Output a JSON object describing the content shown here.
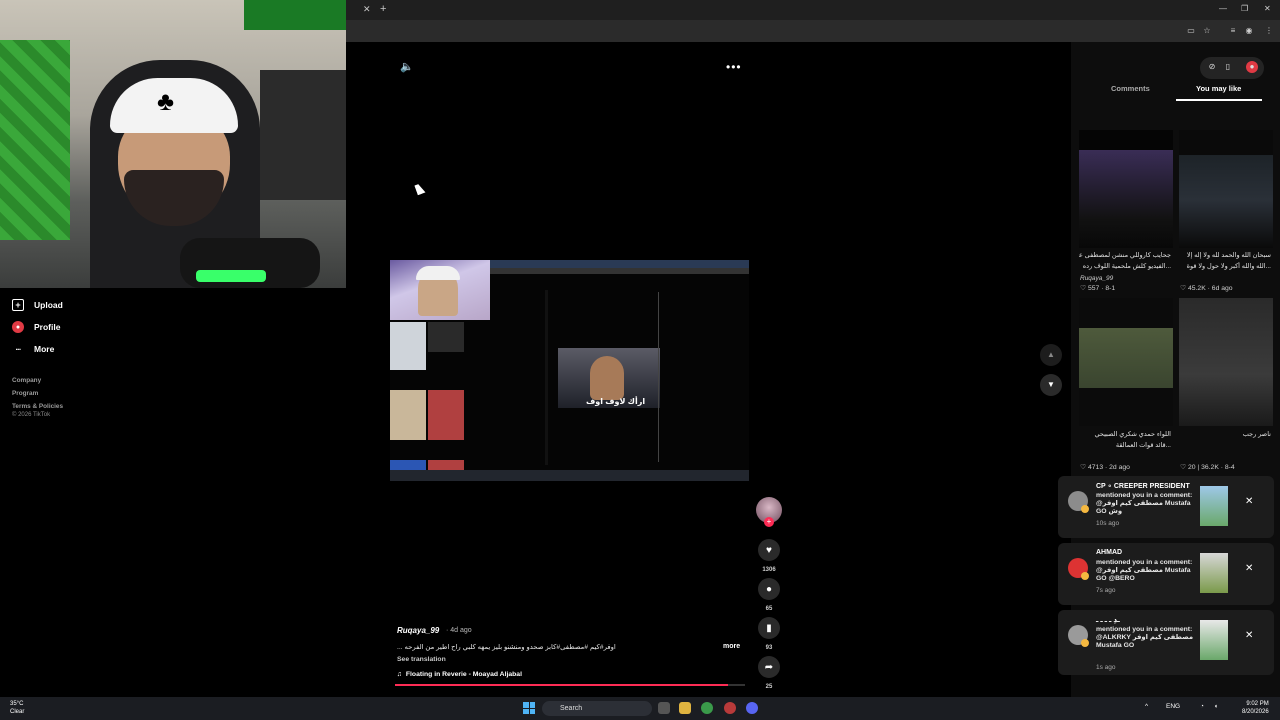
{
  "nav": {
    "upload": "Upload",
    "profile": "Profile",
    "more": "More",
    "footer": [
      "Company",
      "Program",
      "Terms & Policies"
    ],
    "copyright": "© 2026 TikTok"
  },
  "video": {
    "author": "Ruqaya_99",
    "age": "· 4d ago",
    "description": "اوفر#كيم #مصطفى#كابز صحدو ومنشنو بليز يمهه كلبي راح اطير من الفرحه ...",
    "more": "more",
    "see_translation": "See translation",
    "music": "Floating in Reverie - Moayad Aljabal",
    "caption_overlay": "ارأك لاوف اوف",
    "progress": 0.95
  },
  "actions": {
    "likes": "1306",
    "comments": "65",
    "saves": "93",
    "shares": "25"
  },
  "right_panel": {
    "tabs": [
      "Comments",
      "You may like"
    ],
    "active_tab": "You may like",
    "cards": [
      {
        "title": "جحايب كاروللي منشن لمصطفى على",
        "title2": "...الفيديو كلش ملحمية اللوف رده",
        "user": "Ruqaya_99",
        "stats": "557 · 8-1"
      },
      {
        "title": "سبحان الله والحمد لله ولا إله إلا",
        "title2": "...الله والله أكبر ولا حول ولا قوة",
        "user": "",
        "stats": "45.2K · 6d ago"
      },
      {
        "title": "اللواء حمدي شكري الصبيحي",
        "title2": "...قائد قوات العمالقة",
        "user": "",
        "stats": "4713 · 2d ago"
      },
      {
        "title": "ناصر رجب",
        "title2": "",
        "user": "",
        "stats": "20 | 36.2K · 8-4"
      }
    ]
  },
  "notifications": [
    {
      "name": "CP ∘ CREEPER PRESIDENT",
      "text": "mentioned you in a comment: @مصطفى كيم اوفر Mustafa GO وش",
      "time": "10s ago"
    },
    {
      "name": "AHMAD",
      "text": "mentioned you in a comment: @مصطفى كيم اوفر Mustafa GO @BERO",
      "time": "7s ago"
    },
    {
      "name": "ـدِ ـ ـ ـ ـ",
      "text": "mentioned you in a comment: @ALKRKY مصطفى كيم اوفر Mustafa GO",
      "time": "1s ago"
    }
  ],
  "taskbar": {
    "temp": "35°C",
    "weather": "Clear",
    "search": "Search",
    "lang": "ENG",
    "time": "9:02 PM",
    "date": "8/20/2026"
  },
  "colors": {
    "accent": "#fe2c55",
    "profile_red": "#e03a44",
    "panel": "#0d0d0d"
  }
}
